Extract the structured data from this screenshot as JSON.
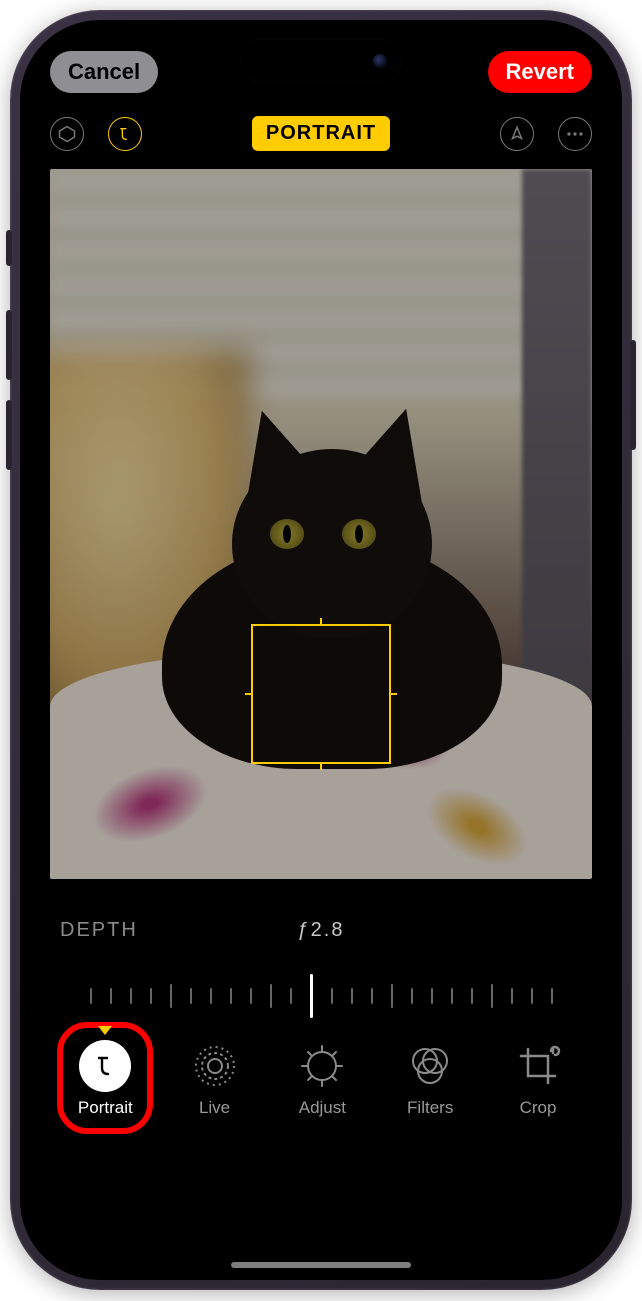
{
  "topbar": {
    "cancel_label": "Cancel",
    "revert_label": "Revert"
  },
  "mode": {
    "badge_label": "PORTRAIT"
  },
  "depth": {
    "label": "DEPTH",
    "value": "ƒ2.8"
  },
  "toolbar": {
    "portrait_label": "Portrait",
    "live_label": "Live",
    "adjust_label": "Adjust",
    "filters_label": "Filters",
    "crop_label": "Crop"
  },
  "icons": {
    "lighting": "portrait-lighting-icon",
    "aperture": "aperture-icon",
    "markup": "markup-icon",
    "more": "more-icon",
    "portrait_f": "f-icon",
    "live": "live-icon",
    "adjust": "adjust-icon",
    "filters": "filters-icon",
    "crop": "crop-icon"
  },
  "colors": {
    "accent": "#ffcc00",
    "danger": "#ff0000",
    "highlight_ring": "#ff0000"
  }
}
